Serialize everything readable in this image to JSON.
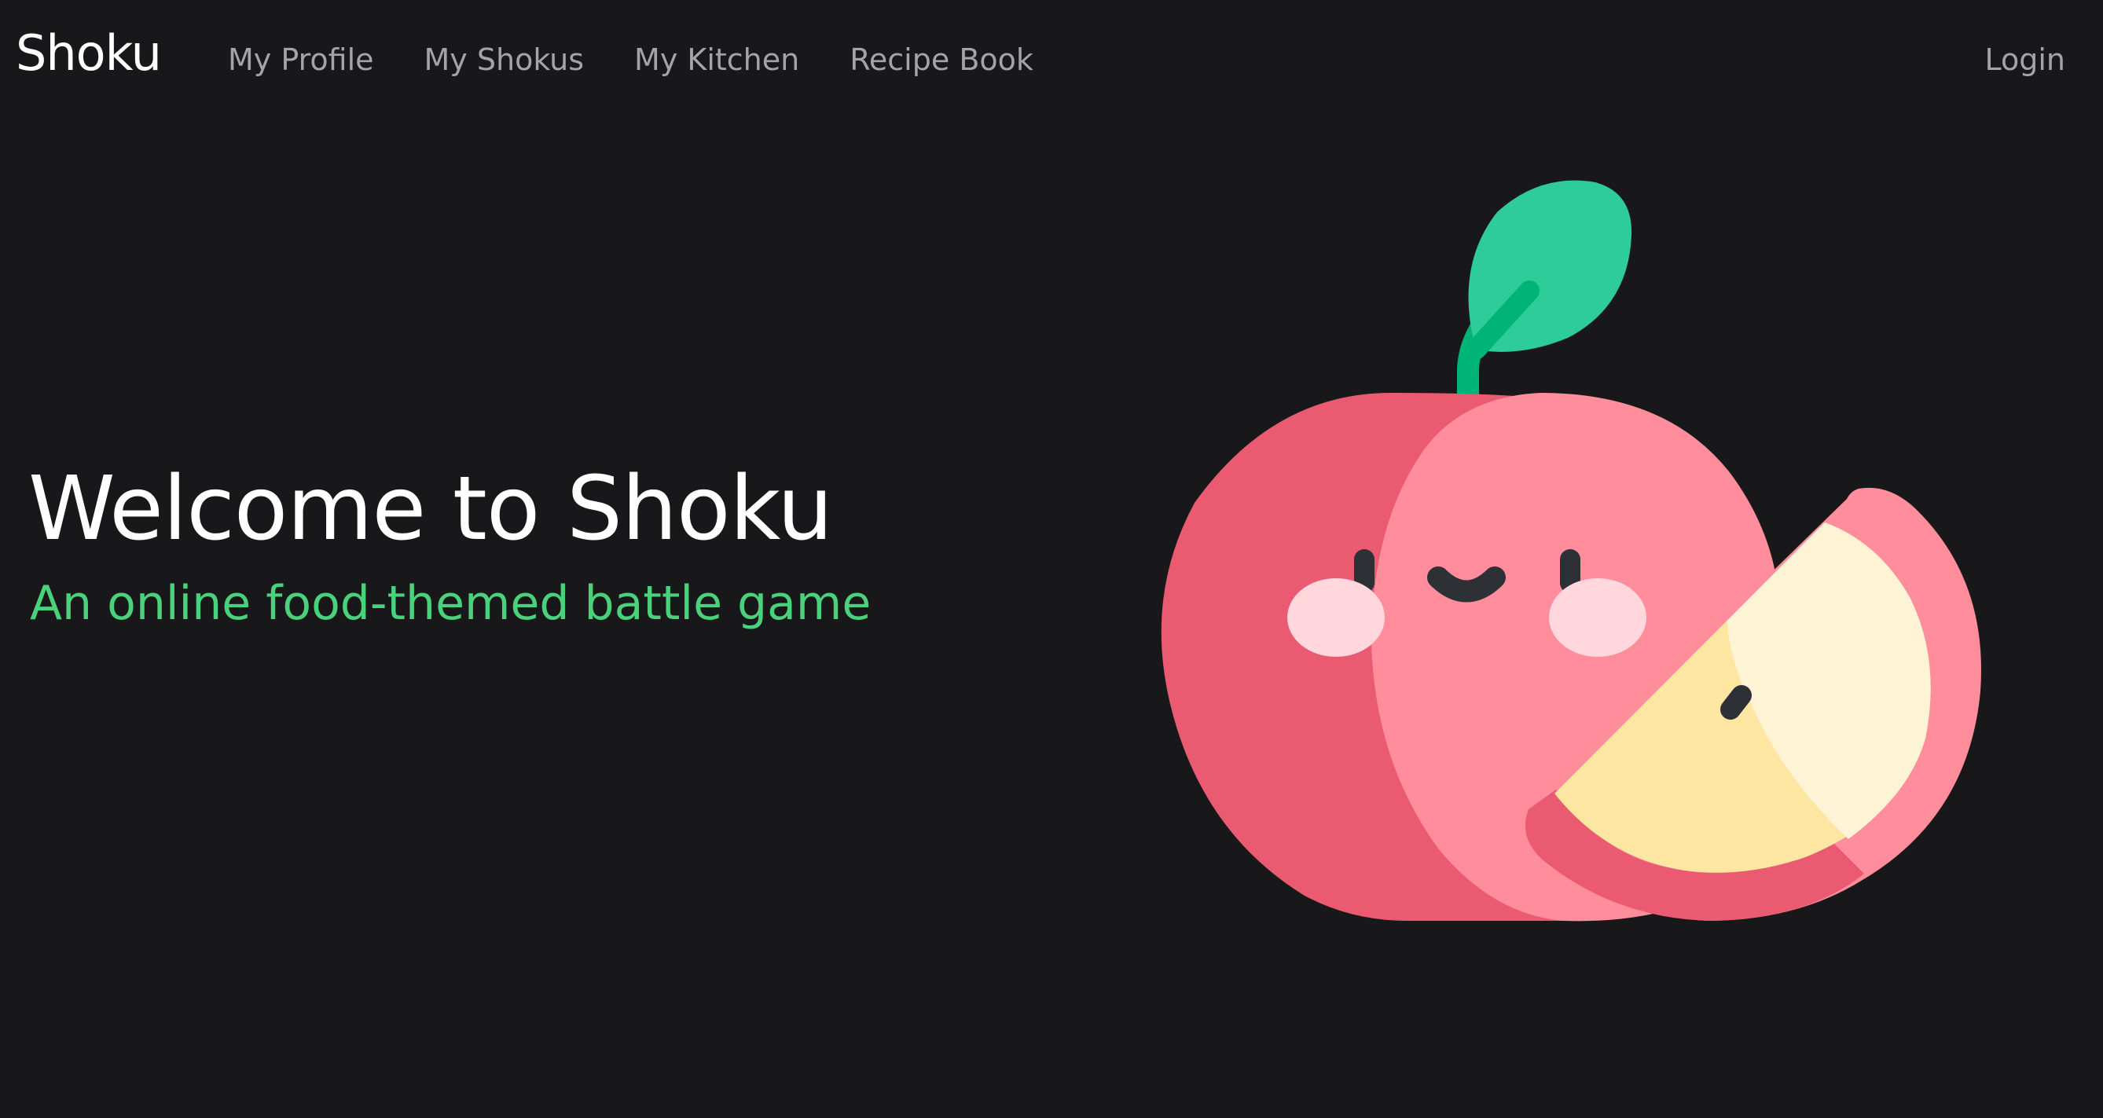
{
  "navbar": {
    "brand": "Shoku",
    "links": [
      {
        "label": "My Profile"
      },
      {
        "label": "My Shokus"
      },
      {
        "label": "My Kitchen"
      },
      {
        "label": "Recipe Book"
      }
    ],
    "login_label": "Login"
  },
  "hero": {
    "title": "Welcome to Shoku",
    "subtitle": "An online food-themed battle game",
    "illustration_icon": "smiling-apple-illustration"
  },
  "colors": {
    "background": "#18181a",
    "accent_green": "#4ad17b",
    "nav_text": "#a3a3a8",
    "apple_red": "#ea5b72",
    "apple_pink": "#ff8d9b",
    "leaf_green": "#2ecc98",
    "apple_flesh": "#fde5a2"
  }
}
